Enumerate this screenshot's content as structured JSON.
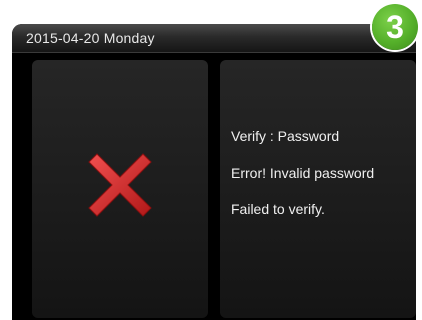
{
  "status_bar": {
    "date": "2015-04-20",
    "weekday": "Monday",
    "display": "2015-04-20  Monday"
  },
  "result_icon": {
    "name": "error-x-icon",
    "color": "#d42a2a"
  },
  "message": {
    "line1": "Verify : Password",
    "line2": "Error! Invalid password",
    "line3": "Failed to verify."
  },
  "step_badge": {
    "number": "3",
    "color": "#55b02a"
  }
}
